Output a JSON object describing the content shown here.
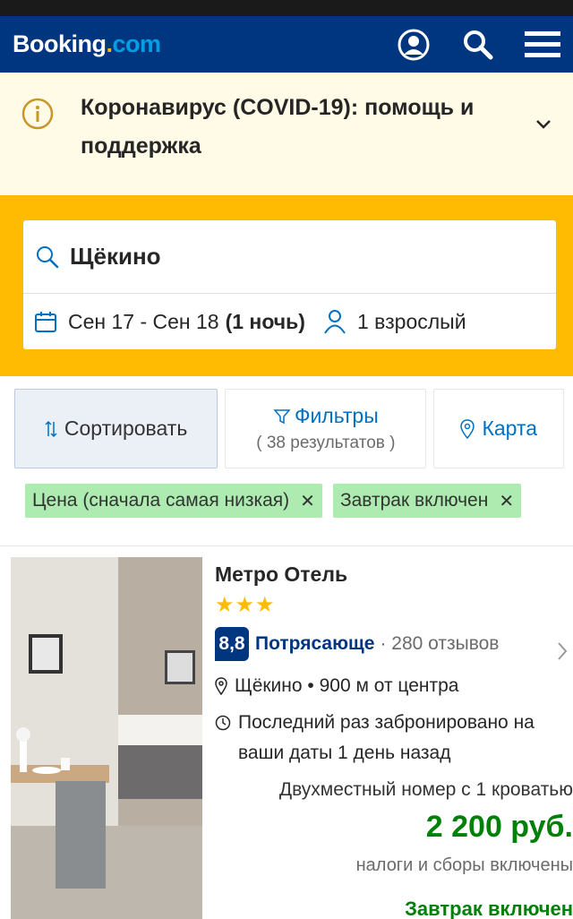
{
  "header": {
    "logo_main": "Booking",
    "logo_dot": ".",
    "logo_com": "com"
  },
  "covid": {
    "text": "Коронавирус (COVID-19): помощь и поддержка"
  },
  "search": {
    "destination": "Щёкино",
    "dates": "Сен 17 - Сен 18",
    "nights": "(1 ночь)",
    "guests": "1 взрослый"
  },
  "controls": {
    "sort_label": "Сортировать",
    "filter_label": "Фильтры",
    "filter_results": "( 38 результатов )",
    "map_label": "Карта"
  },
  "chips": [
    {
      "label": "Цена (сначала самая низкая)"
    },
    {
      "label": "Завтрак включен"
    }
  ],
  "hotel": {
    "name": "Метро Отель",
    "stars": "★★★",
    "score": "8,8",
    "rating_word": "Потрясающе",
    "reviews": "· 280 отзывов",
    "location": "Щёкино • 900 м от центра",
    "booked": "Последний раз забронировано на ваши даты 1 день назад",
    "room": "Двухместный номер с 1 кроватью",
    "price": "2 200 руб.",
    "taxes": "налоги и сборы включены",
    "breakfast": "Завтрак включен"
  },
  "colors": {
    "brand": "#003580",
    "accent": "#febb02",
    "link": "#0071c2",
    "green": "#008009",
    "chip": "#aeebb0"
  }
}
